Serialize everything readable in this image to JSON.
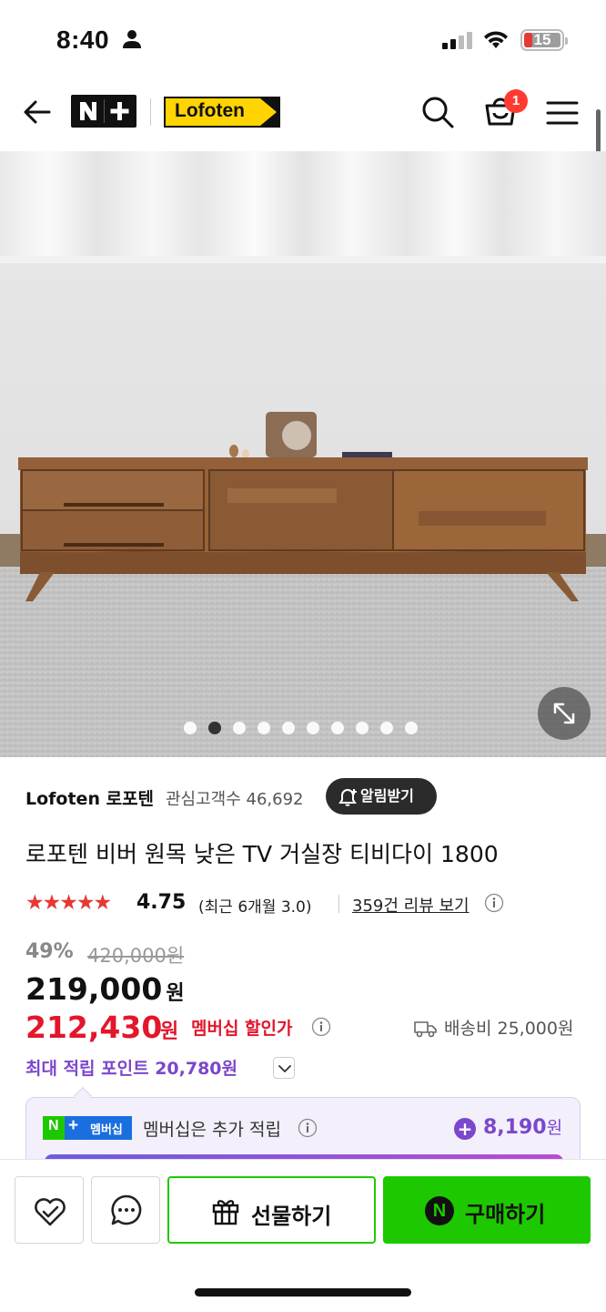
{
  "status_bar": {
    "time": "8:40",
    "battery": "15"
  },
  "header": {
    "nplus_logo": "N+",
    "brand_logo": "Lofoten",
    "cart_count": "1"
  },
  "gallery": {
    "slide_count": 10,
    "active_index": 1
  },
  "store": {
    "name": "Lofoten 로포텐",
    "fans": "관심고객수 46,692",
    "notify_label": "알림받기"
  },
  "product": {
    "title": "로포텐 비버 원목 낮은 TV 거실장 티비다이 1800",
    "stars": "★★★★★",
    "rating": "4.75",
    "recent_rating": "(최근 6개월 3.0)",
    "reviews_link": "359건 리뷰 보기",
    "discount_pct": "49%",
    "original_price": "420,000원",
    "price": "219,000",
    "price_unit": "원",
    "member_price": "212,430",
    "member_unit": "원",
    "member_label": "멤버십 할인가",
    "shipping": "배송비 25,000원",
    "max_points": "최대 적립 포인트 20,780원"
  },
  "membership": {
    "badge_n": "N",
    "badge_plus": "+",
    "badge_text": "멤버십",
    "text": "멤버십은 추가 적립",
    "extra_points": "8,190",
    "extra_unit": "원"
  },
  "bottom_bar": {
    "gift_label": "선물하기",
    "buy_label": "구매하기",
    "npay_letter": "N"
  },
  "colors": {
    "accent_green": "#1ec800",
    "member_red": "#e3162c",
    "points_purple": "#7b47cc"
  }
}
